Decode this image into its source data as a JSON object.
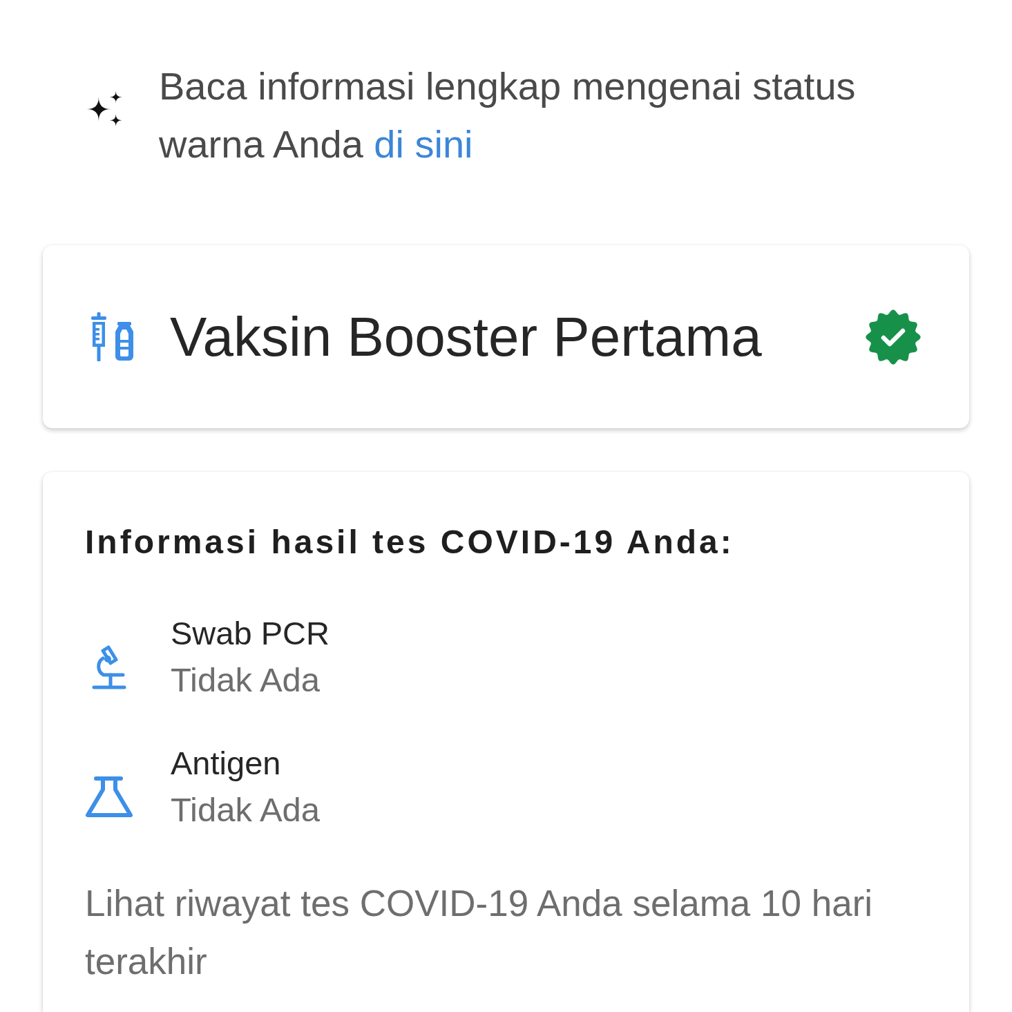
{
  "info": {
    "text": "Baca informasi lengkap mengenai status warna Anda",
    "link": "di sini"
  },
  "vaccine_card": {
    "title": "Vaksin Booster Pertama",
    "verified": true
  },
  "test_card": {
    "heading": "Informasi hasil tes COVID-19 Anda:",
    "tests": [
      {
        "kind": "pcr",
        "name": "Swab PCR",
        "result": "Tidak Ada"
      },
      {
        "kind": "antigen",
        "name": "Antigen",
        "result": "Tidak Ada"
      }
    ],
    "footer": "Lihat riwayat tes COVID-19 Anda selama 10 hari terakhir"
  }
}
